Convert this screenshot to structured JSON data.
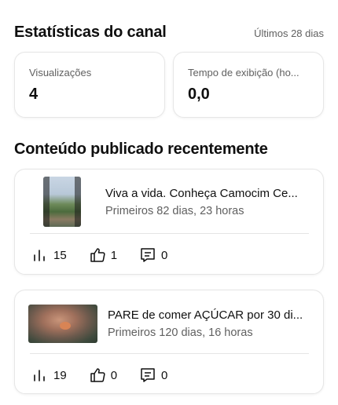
{
  "stats": {
    "title": "Estatísticas do canal",
    "period": "Últimos 28 dias",
    "metrics": [
      {
        "label": "Visualizações",
        "value": "4"
      },
      {
        "label": "Tempo de exibição (ho...",
        "value": "0,0"
      }
    ]
  },
  "recent": {
    "title": "Conteúdo publicado recentemente",
    "videos": [
      {
        "title": "Viva a vida. Conheça Camocim Ce...",
        "subtitle": "Primeiros 82 dias, 23 horas",
        "views": "15",
        "likes": "1",
        "comments": "0"
      },
      {
        "title": "PARE de comer AÇÚCAR por 30 di...",
        "subtitle": "Primeiros 120 dias, 16 horas",
        "views": "19",
        "likes": "0",
        "comments": "0"
      }
    ]
  },
  "icons": {
    "views": "bar-chart-icon",
    "likes": "thumb-up-icon",
    "comments": "comment-icon"
  }
}
